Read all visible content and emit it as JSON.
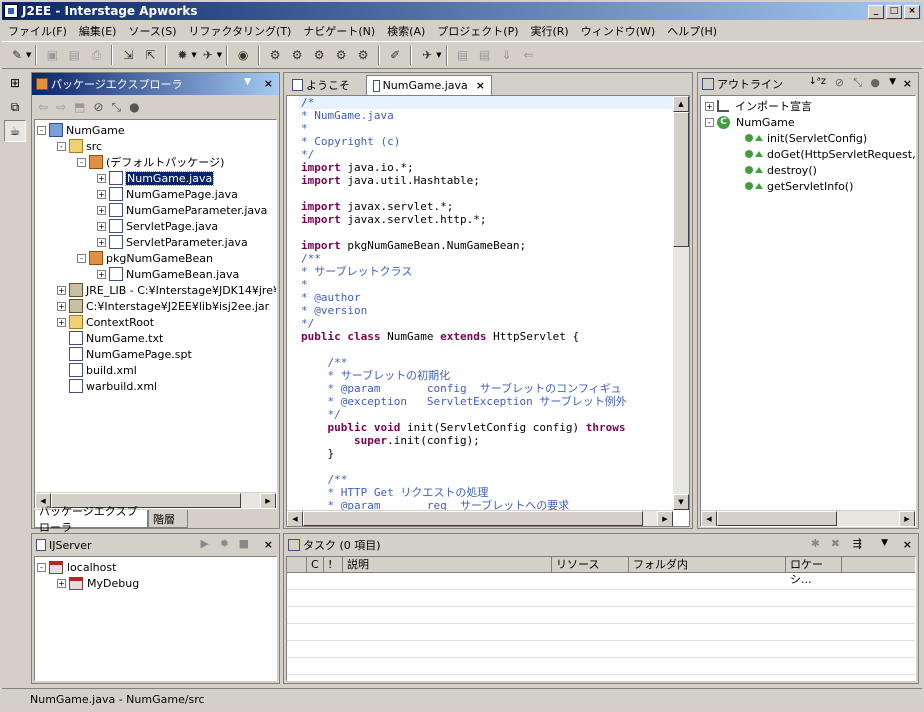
{
  "window": {
    "title": "J2EE - Interstage Apworks"
  },
  "menu": [
    "ファイル(F)",
    "編集(E)",
    "ソース(S)",
    "リファクタリング(T)",
    "ナビゲート(N)",
    "検索(A)",
    "プロジェクト(P)",
    "実行(R)",
    "ウィンドウ(W)",
    "ヘルプ(H)"
  ],
  "explorer": {
    "title": "パッケージエクスプローラ",
    "tabs": [
      "パッケージエクスプローラ",
      "階層"
    ],
    "tree": [
      {
        "label": "NumGame",
        "indent": 0,
        "icon": "project",
        "tw": "-"
      },
      {
        "label": "src",
        "indent": 1,
        "icon": "folder",
        "tw": "-"
      },
      {
        "label": "(デフォルトパッケージ)",
        "indent": 2,
        "icon": "package",
        "tw": "-"
      },
      {
        "label": "NumGame.java",
        "indent": 3,
        "icon": "java",
        "tw": "+",
        "selected": true
      },
      {
        "label": "NumGamePage.java",
        "indent": 3,
        "icon": "java",
        "tw": "+"
      },
      {
        "label": "NumGameParameter.java",
        "indent": 3,
        "icon": "java",
        "tw": "+"
      },
      {
        "label": "ServletPage.java",
        "indent": 3,
        "icon": "java",
        "tw": "+"
      },
      {
        "label": "ServletParameter.java",
        "indent": 3,
        "icon": "java",
        "tw": "+"
      },
      {
        "label": "pkgNumGameBean",
        "indent": 2,
        "icon": "package",
        "tw": "-"
      },
      {
        "label": "NumGameBean.java",
        "indent": 3,
        "icon": "java",
        "tw": "+"
      },
      {
        "label": "JRE_LIB - C:¥Interstage¥JDK14¥jre¥",
        "indent": 1,
        "icon": "jar",
        "tw": "+"
      },
      {
        "label": "C:¥Interstage¥J2EE¥lib¥isj2ee.jar",
        "indent": 1,
        "icon": "jar",
        "tw": "+"
      },
      {
        "label": "ContextRoot",
        "indent": 1,
        "icon": "folder",
        "tw": "+"
      },
      {
        "label": "NumGame.txt",
        "indent": 1,
        "icon": "file",
        "tw": ""
      },
      {
        "label": "NumGamePage.spt",
        "indent": 1,
        "icon": "file",
        "tw": ""
      },
      {
        "label": "build.xml",
        "indent": 1,
        "icon": "xml",
        "tw": ""
      },
      {
        "label": "warbuild.xml",
        "indent": 1,
        "icon": "xml",
        "tw": ""
      }
    ]
  },
  "editor": {
    "tabs": [
      "ようこそ",
      "NumGame.java"
    ],
    "lines": [
      [
        [
          "c",
          "/*"
        ]
      ],
      [
        [
          "c",
          "* NumGame.java"
        ]
      ],
      [
        [
          "c",
          "*"
        ]
      ],
      [
        [
          "c",
          "* Copyright (c)"
        ]
      ],
      [
        [
          "c",
          "*/"
        ]
      ],
      [
        [
          "k",
          "import"
        ],
        [
          "n",
          " java.io.*;"
        ]
      ],
      [
        [
          "k",
          "import"
        ],
        [
          "n",
          " java.util.Hashtable;"
        ]
      ],
      [
        [
          "n",
          ""
        ]
      ],
      [
        [
          "k",
          "import"
        ],
        [
          "n",
          " javax.servlet.*;"
        ]
      ],
      [
        [
          "k",
          "import"
        ],
        [
          "n",
          " javax.servlet.http.*;"
        ]
      ],
      [
        [
          "n",
          ""
        ]
      ],
      [
        [
          "k",
          "import"
        ],
        [
          "n",
          " pkgNumGameBean.NumGameBean;"
        ]
      ],
      [
        [
          "c",
          "/**"
        ]
      ],
      [
        [
          "c",
          "* サーブレットクラス"
        ]
      ],
      [
        [
          "c",
          "*"
        ]
      ],
      [
        [
          "c",
          "* @author"
        ]
      ],
      [
        [
          "c",
          "* @version"
        ]
      ],
      [
        [
          "c",
          "*/"
        ]
      ],
      [
        [
          "k",
          "public class"
        ],
        [
          "n",
          " NumGame "
        ],
        [
          "k",
          "extends"
        ],
        [
          "n",
          " HttpServlet {"
        ]
      ],
      [
        [
          "n",
          ""
        ]
      ],
      [
        [
          "c",
          "    /**"
        ]
      ],
      [
        [
          "c",
          "    * サーブレットの初期化"
        ]
      ],
      [
        [
          "c",
          "    * @param       config  サーブレットのコンフィギュ"
        ]
      ],
      [
        [
          "c",
          "    * @exception   ServletException サーブレット例外"
        ]
      ],
      [
        [
          "c",
          "    */"
        ]
      ],
      [
        [
          "k",
          "    public void"
        ],
        [
          "n",
          " init(ServletConfig config) "
        ],
        [
          "k",
          "throws"
        ]
      ],
      [
        [
          "k",
          "        super"
        ],
        [
          "n",
          ".init(config);"
        ]
      ],
      [
        [
          "n",
          "    }"
        ]
      ],
      [
        [
          "n",
          ""
        ]
      ],
      [
        [
          "c",
          "    /**"
        ]
      ],
      [
        [
          "c",
          "    * HTTP Get リクエストの処理"
        ]
      ],
      [
        [
          "c",
          "    * @param       req  サーブレットへの要求"
        ]
      ]
    ]
  },
  "outline": {
    "title": "アウトライン",
    "items": [
      {
        "label": "インポート宣言",
        "indent": 0,
        "tw": "+",
        "icon": "imports"
      },
      {
        "label": "NumGame",
        "indent": 0,
        "tw": "-",
        "icon": "class"
      },
      {
        "label": "init(ServletConfig)",
        "indent": 1,
        "tw": "",
        "icon": "method"
      },
      {
        "label": "doGet(HttpServletRequest,",
        "indent": 1,
        "tw": "",
        "icon": "method"
      },
      {
        "label": "destroy()",
        "indent": 1,
        "tw": "",
        "icon": "method"
      },
      {
        "label": "getServletInfo()",
        "indent": 1,
        "tw": "",
        "icon": "method"
      }
    ]
  },
  "server": {
    "title": "IJServer",
    "items": [
      {
        "label": "localhost",
        "indent": 0,
        "tw": "-"
      },
      {
        "label": "MyDebug",
        "indent": 1,
        "tw": "+"
      }
    ]
  },
  "tasks": {
    "title": "タスク (0 項目)",
    "columns": [
      "C",
      "!",
      "説明",
      "リソース",
      "フォルダ内",
      "ロケーシ..."
    ]
  },
  "status": {
    "text": "NumGame.java - NumGame/src"
  },
  "colors": {
    "keyword": "#7f0055",
    "comment": "#3f5fbf",
    "active_title": "#0a246a"
  }
}
